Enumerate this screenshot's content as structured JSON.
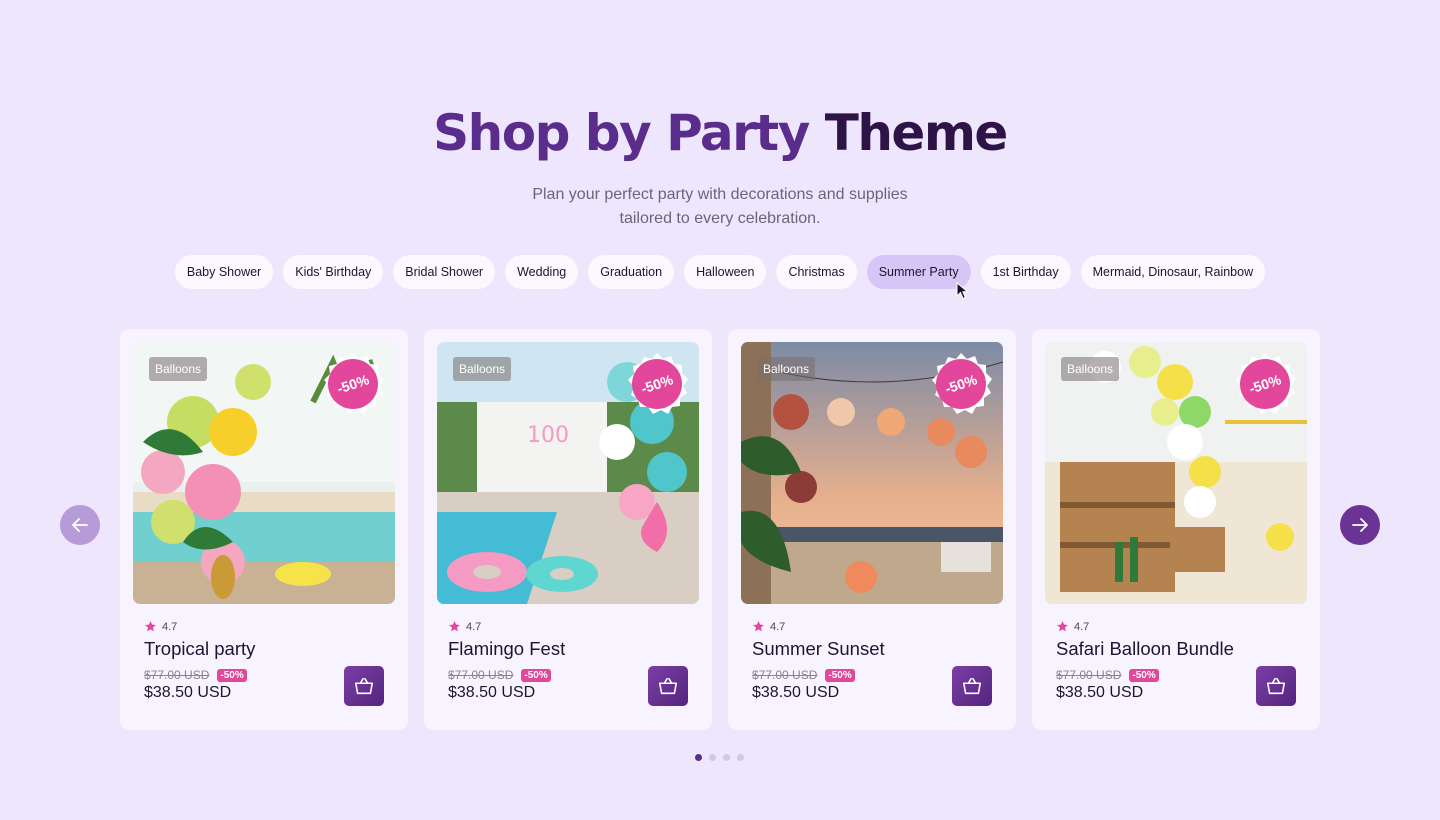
{
  "header": {
    "title_part1": "Shop by Party",
    "title_part2": "Theme",
    "subtitle_line1": "Plan your perfect party with decorations and supplies",
    "subtitle_line2": "tailored to every celebration."
  },
  "themes": [
    {
      "label": "Baby Shower",
      "active": false
    },
    {
      "label": "Kids' Birthday",
      "active": false
    },
    {
      "label": "Bridal Shower",
      "active": false
    },
    {
      "label": "Wedding",
      "active": false
    },
    {
      "label": "Graduation",
      "active": false
    },
    {
      "label": "Halloween",
      "active": false
    },
    {
      "label": "Christmas",
      "active": false
    },
    {
      "label": "Summer Party",
      "active": true
    },
    {
      "label": "1st Birthday",
      "active": false
    },
    {
      "label": "Mermaid, Dinosaur, Rainbow",
      "active": false
    }
  ],
  "products": [
    {
      "category": "Balloons",
      "discount_badge": "-50%",
      "rating": "4.7",
      "name": "Tropical party",
      "old_price": "$77.00 USD",
      "discount_tag": "-50%",
      "price": "$38.50 USD"
    },
    {
      "category": "Balloons",
      "discount_badge": "-50%",
      "rating": "4.7",
      "name": "Flamingo Fest",
      "old_price": "$77.00 USD",
      "discount_tag": "-50%",
      "price": "$38.50 USD"
    },
    {
      "category": "Balloons",
      "discount_badge": "-50%",
      "rating": "4.7",
      "name": "Summer Sunset",
      "old_price": "$77.00 USD",
      "discount_tag": "-50%",
      "price": "$38.50 USD"
    },
    {
      "category": "Balloons",
      "discount_badge": "-50%",
      "rating": "4.7",
      "name": "Safari Balloon Bundle",
      "old_price": "$77.00 USD",
      "discount_tag": "-50%",
      "price": "$38.50 USD"
    }
  ],
  "carousel": {
    "pages": 4,
    "current_page": 1
  },
  "icons": {
    "prev": "arrow-left-icon",
    "next": "arrow-right-icon",
    "cart": "shopping-basket-icon",
    "rating": "star-icon"
  },
  "colors": {
    "background": "#ede6fd",
    "accent": "#6b3494",
    "badge": "#e3479b",
    "active_chip": "#d6c6f7"
  }
}
